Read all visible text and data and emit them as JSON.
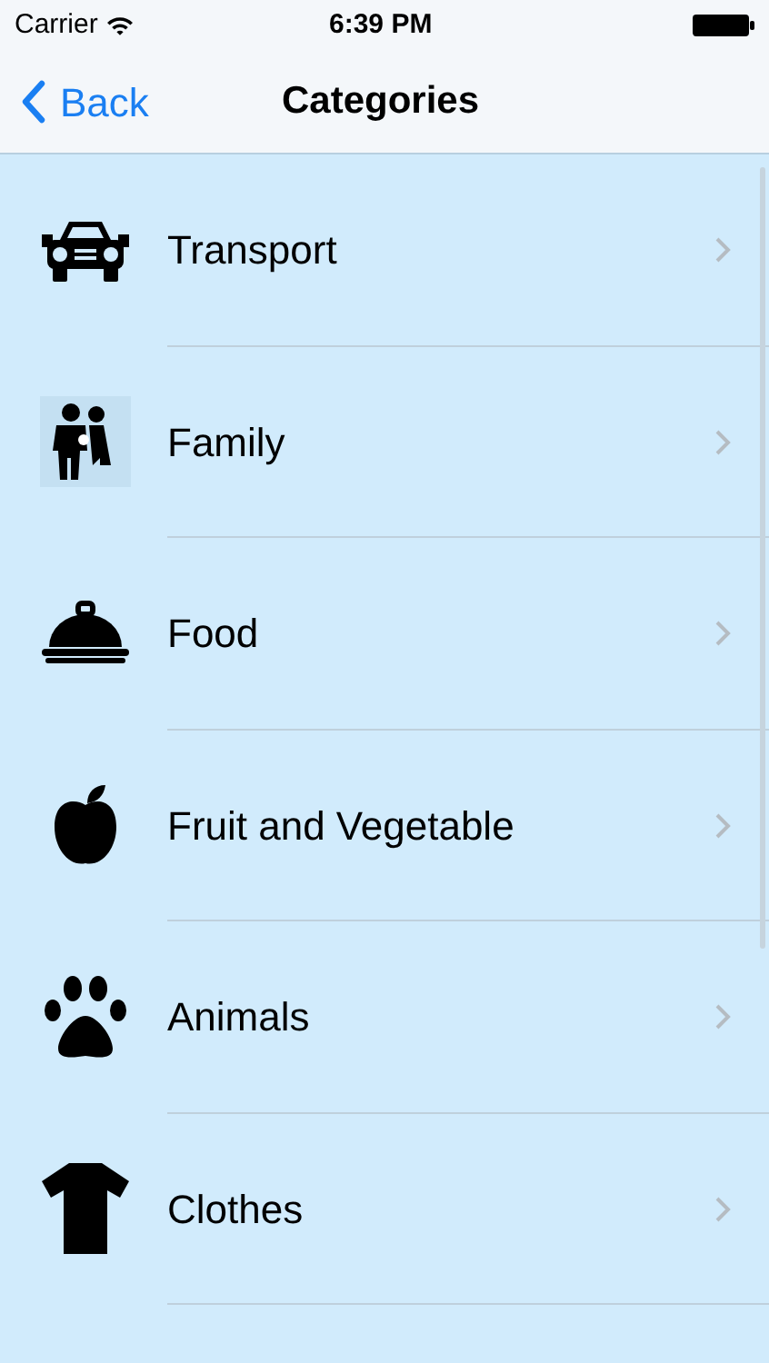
{
  "status_bar": {
    "carrier": "Carrier",
    "time": "6:39 PM"
  },
  "nav_bar": {
    "back": "Back",
    "title": "Categories"
  },
  "categories": [
    {
      "label": "Transport",
      "kind": "car"
    },
    {
      "label": "Family",
      "kind": "family"
    },
    {
      "label": "Food",
      "kind": "food"
    },
    {
      "label": "Fruit and Vegetable",
      "kind": "apple"
    },
    {
      "label": "Animals",
      "kind": "paw"
    },
    {
      "label": "Clothes",
      "kind": "shirt"
    }
  ]
}
